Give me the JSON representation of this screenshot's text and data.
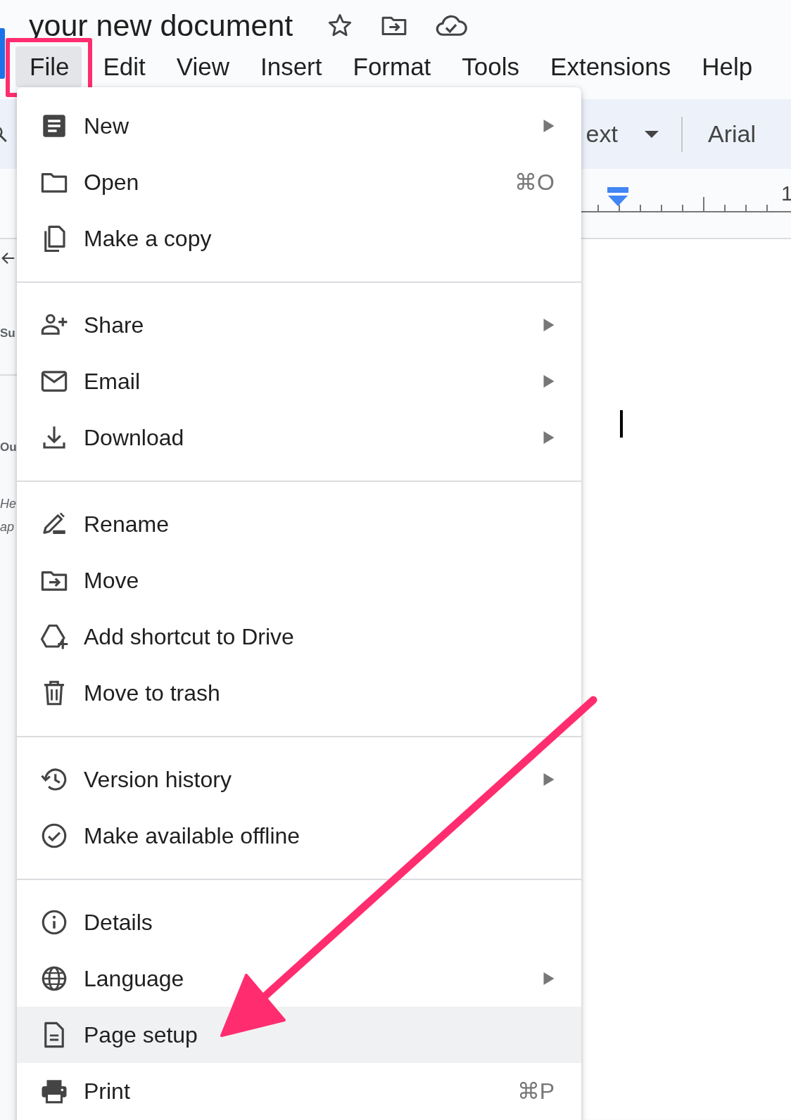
{
  "document": {
    "title": "your new document"
  },
  "menu_bar": [
    {
      "label": "File",
      "selected": true,
      "annotated": true
    },
    {
      "label": "Edit",
      "selected": false,
      "annotated": false
    },
    {
      "label": "View",
      "selected": false,
      "annotated": false
    },
    {
      "label": "Insert",
      "selected": false,
      "annotated": false
    },
    {
      "label": "Format",
      "selected": false,
      "annotated": false
    },
    {
      "label": "Tools",
      "selected": false,
      "annotated": false
    },
    {
      "label": "Extensions",
      "selected": false,
      "annotated": false
    },
    {
      "label": "Help",
      "selected": false,
      "annotated": false
    }
  ],
  "toolbar": {
    "style_field": "ext",
    "font_field": "Arial"
  },
  "ruler": {
    "label": "1"
  },
  "sidebar": {
    "texts": [
      {
        "text": "Su",
        "kind": "heading"
      },
      {
        "text": "Ou",
        "kind": "heading"
      },
      {
        "text": "He",
        "kind": "hint"
      },
      {
        "text": "ap",
        "kind": "hint"
      }
    ]
  },
  "file_menu": {
    "groups": [
      {
        "items": [
          {
            "label": "New",
            "submenu": true,
            "highlighted": false
          },
          {
            "label": "Open",
            "shortcut": "⌘O",
            "submenu": false,
            "highlighted": false
          },
          {
            "label": "Make a copy",
            "submenu": false,
            "highlighted": false
          }
        ]
      },
      {
        "items": [
          {
            "label": "Share",
            "submenu": true,
            "highlighted": false
          },
          {
            "label": "Email",
            "submenu": true,
            "highlighted": false
          },
          {
            "label": "Download",
            "submenu": true,
            "highlighted": false
          }
        ]
      },
      {
        "items": [
          {
            "label": "Rename",
            "submenu": false,
            "highlighted": false
          },
          {
            "label": "Move",
            "submenu": false,
            "highlighted": false
          },
          {
            "label": "Add shortcut to Drive",
            "submenu": false,
            "highlighted": false
          },
          {
            "label": "Move to trash",
            "submenu": false,
            "highlighted": false
          }
        ]
      },
      {
        "items": [
          {
            "label": "Version history",
            "submenu": true,
            "highlighted": false
          },
          {
            "label": "Make available offline",
            "submenu": false,
            "highlighted": false
          }
        ]
      },
      {
        "items": [
          {
            "label": "Details",
            "submenu": false,
            "highlighted": false
          },
          {
            "label": "Language",
            "submenu": true,
            "highlighted": false
          },
          {
            "label": "Page setup",
            "submenu": false,
            "highlighted": true
          },
          {
            "label": "Print",
            "shortcut": "⌘P",
            "submenu": false,
            "highlighted": false
          }
        ]
      }
    ]
  },
  "annotations": {
    "pointer_arrow": true
  }
}
